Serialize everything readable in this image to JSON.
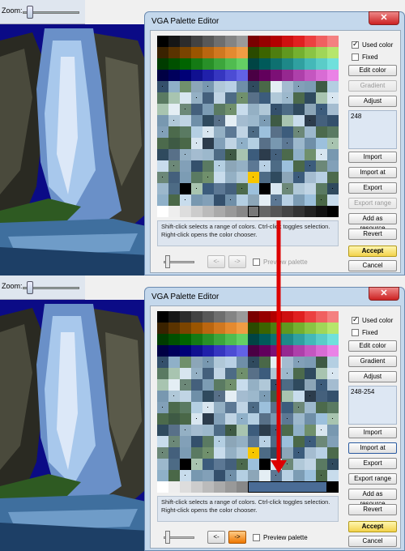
{
  "zoom_label": "Zoom:",
  "dialog_title": "VGA Palette Editor",
  "close_symbol": "✕",
  "top_rows": [
    "#000000 #161616 #2c2c2c #424242 #585858 #6e6e6e #848484 #9a9a9a #7a0000 #960000 #b20000 #ce1010 #e02020 #ec4040 #f06060 #f48080",
    "#3a2200 #5a3300 #7a4400 #9a5500 #ba6610 #d07820 #e48a30 #f09c44 #2a4a00 #3c6400 #4e7e10 #609820 #74b030 #8ac444 #a0d658 #b6e66c",
    "#003c00 #005000 #006400 #147a14 #289028 #3ca63c #50bc50 #64d064 #004444 #005a5a #0e7070 #1e8888 #30a0a0 #44b8b8 #5accc8 #70e0dc",
    "#000044 #00005c #000076 #101090 #2020aa #3636c0 #4c4cd4 #6262e6 #4a0044 #62005c #7c1076 #962890 #ae40aa #c456c0 #d86cd4 #ea82e6"
  ],
  "body_colors": [
    "#6f8fa8",
    "#4d6b85",
    "#8fb0c8",
    "#5a7a62",
    "#3e5a44",
    "#9cc0dc",
    "#2f4a5e",
    "#b4cfe2",
    "#70906c",
    "#4a6848",
    "#a8c4b0",
    "#8ca6b8",
    "#587088",
    "#c8dcec",
    "#d8e6f0",
    "#e4eef4",
    "#3c5c7c",
    "#7898b0",
    "#94b0c4",
    "#2c3c4c",
    "#6c8878",
    "#a4bcd0",
    "#5c7894",
    "#b0c8d8",
    "#82a0b8",
    "#44607c",
    "#b8d0e4",
    "#9cb8cc",
    "#34506c",
    "#c0d4e4",
    "#7c9cb4",
    "#4c6a4c"
  ],
  "top": {
    "index_text": "248",
    "hint": "Shift-click selects a range of colors. Ctrl-click toggles selection. Right-click opens the color chooser.",
    "buttons": {
      "used_color": "Used color",
      "fixed": "Fixed",
      "edit_color": "Edit color",
      "gradient": "Gradient",
      "adjust": "Adjust",
      "import": "Import",
      "import_at": "Import at",
      "export": "Export",
      "export_range": "Export range",
      "add_resource": "Add as resource",
      "revert": "Revert",
      "accept": "Accept",
      "cancel": "Cancel"
    },
    "nav": {
      "prev": "<-",
      "next": "->"
    },
    "preview": "Preview palette"
  },
  "bottom": {
    "index_text": "248-254",
    "hint": "Shift-click selects a range of colors. Ctrl-click toggles selection. Right-click opens the color chooser.",
    "buttons": {
      "used_color": "Used color",
      "fixed": "Fixed",
      "edit_color": "Edit color",
      "gradient": "Gradient",
      "adjust": "Adjust",
      "import": "Import",
      "import_at": "Import at",
      "export": "Export",
      "export_range": "Export range",
      "add_resource": "Add as resource",
      "revert": "Revert",
      "accept": "Accept",
      "cancel": "Cancel"
    },
    "nav": {
      "prev": "<-",
      "next": "->"
    },
    "preview": "Preview palette"
  },
  "colors": {
    "accent_arrow": "#dd0000",
    "title_bar": "#c4d8ec",
    "highlight_cell": "#f7c600",
    "scene_bg": "#0b0b86"
  }
}
